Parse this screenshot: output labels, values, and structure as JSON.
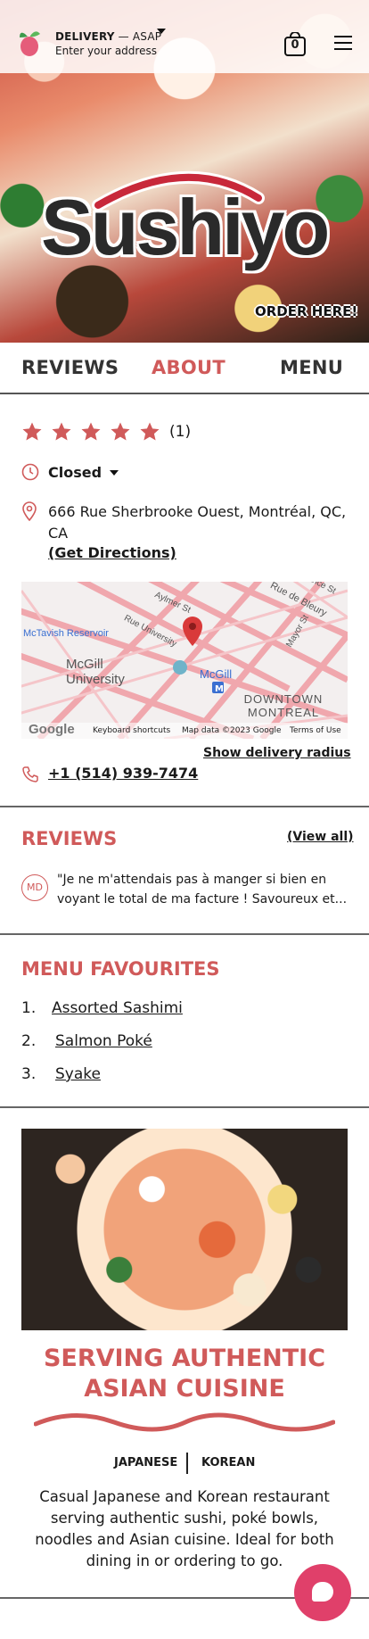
{
  "header": {
    "delivery_label": "DELIVERY",
    "delivery_separator": " — ",
    "delivery_time": "ASAP",
    "address_prompt": "Enter your address",
    "cart_count": "0"
  },
  "hero": {
    "logo_text": "Sushiyo",
    "order_here": "ORDER HERE!"
  },
  "tabs": [
    {
      "label": "REVIEWS",
      "active": false
    },
    {
      "label": "ABOUT",
      "active": true
    },
    {
      "label": "MENU",
      "active": false
    }
  ],
  "info": {
    "rating": 5,
    "rating_count": "(1)",
    "status": "Closed",
    "address": "666 Rue Sherbrooke Ouest, Montréal, QC, CA",
    "directions": "(Get Directions)",
    "delivery_radius": "Show delivery radius",
    "phone": "+1 (514) 939-7474"
  },
  "map": {
    "labels": {
      "mctavish": "McTavish Reservoir",
      "mcgill_univ": "McGill University",
      "mcgill_station": "McGill",
      "downtown": "DOWNTOWN MONTREAL",
      "aylmer": "Aylmer St",
      "university": "Rue University",
      "bleury": "Rue de Bleury",
      "mayor": "Mayor St",
      "france": "ance St"
    },
    "footer": {
      "google": "Google",
      "shortcuts": "Keyboard shortcuts",
      "map_data": "Map data ©2023 Google",
      "terms": "Terms of Use"
    }
  },
  "reviews": {
    "title": "REVIEWS",
    "view_all": "(View all)",
    "items": [
      {
        "initials": "MD",
        "text": "\"Je ne m'attendais pas à manger si bien en voyant le total de ma facture ! Savoureux et..."
      }
    ]
  },
  "favourites": {
    "title": "MENU FAVOURITES",
    "items": [
      {
        "num": "1.",
        "name": "Assorted Sashimi"
      },
      {
        "num": "2.",
        "name": "Salmon Poké"
      },
      {
        "num": "3.",
        "name": "Syake"
      }
    ]
  },
  "about": {
    "heading": "SERVING AUTHENTIC ASIAN CUISINE",
    "cuisines": [
      "JAPANESE",
      "KOREAN"
    ],
    "description": "Casual Japanese and Korean restaurant serving authentic sushi, poké bowls, noodles and Asian cuisine. Ideal for both dining in or ordering to go."
  },
  "colors": {
    "accent": "#d05a5a",
    "chat_button": "#e0406a",
    "star": "#d05a5a"
  },
  "icons": {
    "brand": "brand-fruit-icon",
    "cart": "shopping-bag-icon",
    "menu": "hamburger-menu-icon",
    "status": "clock-icon",
    "address": "location-pin-icon",
    "phone": "phone-icon",
    "chat": "chat-bubble-icon"
  }
}
